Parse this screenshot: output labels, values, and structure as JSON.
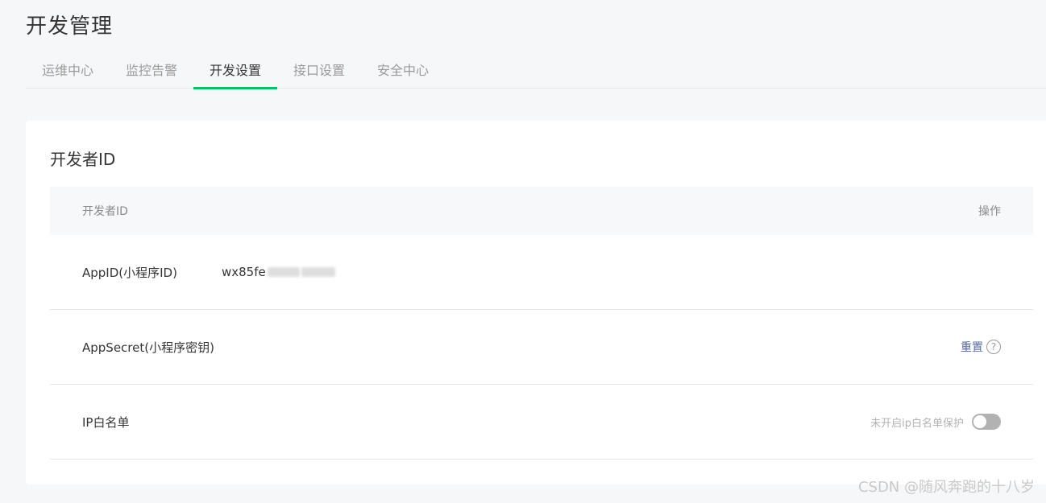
{
  "page": {
    "title": "开发管理"
  },
  "tabs": [
    {
      "label": "运维中心"
    },
    {
      "label": "监控告警"
    },
    {
      "label": "开发设置"
    },
    {
      "label": "接口设置"
    },
    {
      "label": "安全中心"
    }
  ],
  "active_tab": "开发设置",
  "card": {
    "title": "开发者ID",
    "table": {
      "header": {
        "col1": "开发者ID",
        "col2": "操作"
      },
      "rows": [
        {
          "label": "AppID(小程序ID)",
          "value": "wx85fe"
        },
        {
          "label": "AppSecret(小程序密钥)",
          "action": "重置",
          "help_icon": "question-circle-icon"
        },
        {
          "label": "IP白名单",
          "switch_label": "未开启ip白名单保护",
          "switch_on": false
        }
      ]
    }
  },
  "watermark": "CSDN @随风奔跑的十八岁",
  "colors": {
    "accent": "#07c160",
    "link": "#576b95"
  }
}
